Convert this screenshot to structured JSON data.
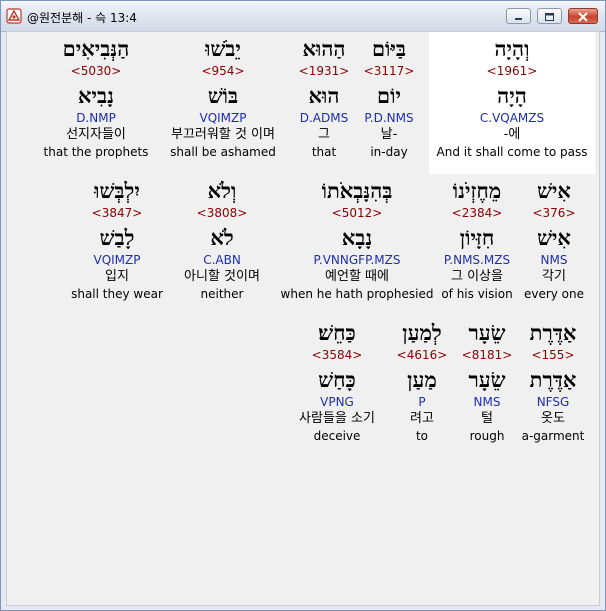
{
  "window": {
    "title": "@원전분해 - 슥 13:4"
  },
  "words": [
    {
      "heb": "וְהָיָה",
      "num": "<1961>",
      "lex": "הָיָה",
      "parse": "C.VQAMZS",
      "kor": "-에",
      "eng": "And it shall come to pass"
    },
    {
      "heb": "בַּיּוֹם",
      "num": "<3117>",
      "lex": "יוֹם",
      "parse": "P.D.NMS",
      "kor": "날-",
      "eng": "in-day"
    },
    {
      "heb": "הַהוּא",
      "num": "<1931>",
      "lex": "הוּא",
      "parse": "D.ADMS",
      "kor": "그",
      "eng": "that"
    },
    {
      "heb": "יֵבֹשׁוּ",
      "num": "<954>",
      "lex": "בּוֹשׁ",
      "parse": "VQIMZP",
      "kor": "부끄러워할 것 이며",
      "eng": "shall be ashamed"
    },
    {
      "heb": "הַנְּבִיאִים",
      "num": "<5030>",
      "lex": "נָבִיא",
      "parse": "D.NMP",
      "kor": "선지자들이",
      "eng": "that the prophets"
    },
    {
      "heb": "אִישׁ",
      "num": "<376>",
      "lex": "אִישׁ",
      "parse": "NMS",
      "kor": "각기",
      "eng": "every one"
    },
    {
      "heb": "מֵחֶזְיֹנוֹ",
      "num": "<2384>",
      "lex": "חִזָּיוֹן",
      "parse": "P.NMS.MZS",
      "kor": "그 이상을",
      "eng": "of his vision"
    },
    {
      "heb": "בְּהִנָּבְאֹתוֹ",
      "num": "<5012>",
      "lex": "נָבָא",
      "parse": "P.VNNGFP.MZS",
      "kor": "예언할 때에",
      "eng": "when he hath prophesied"
    },
    {
      "heb": "וְלֹא",
      "num": "<3808>",
      "lex": "לֹא",
      "parse": "C.ABN",
      "kor": "아니할 것이며",
      "eng": "neither"
    },
    {
      "heb": "יִלְבְּשׁוּ",
      "num": "<3847>",
      "lex": "לָבַשׁ",
      "parse": "VQIMZP",
      "kor": "입지",
      "eng": "shall they wear"
    },
    {
      "heb": "אַדֶּרֶת",
      "num": "<155>",
      "lex": "אַדֶּרֶת",
      "parse": "NFSG",
      "kor": "옷도",
      "eng": "a-garment"
    },
    {
      "heb": "שֵׂעָר",
      "num": "<8181>",
      "lex": "שֵׂעָר",
      "parse": "NMS",
      "kor": "털",
      "eng": "rough"
    },
    {
      "heb": "לְמַעַן",
      "num": "<4616>",
      "lex": "מַעַן",
      "parse": "P",
      "kor": "려고",
      "eng": "to"
    },
    {
      "heb": "כַּחֵשׁ׃",
      "num": "<3584>",
      "lex": "כָּחַשׁ",
      "parse": "VPNG",
      "kor": "사람들을 소기",
      "eng": "deceive"
    }
  ]
}
